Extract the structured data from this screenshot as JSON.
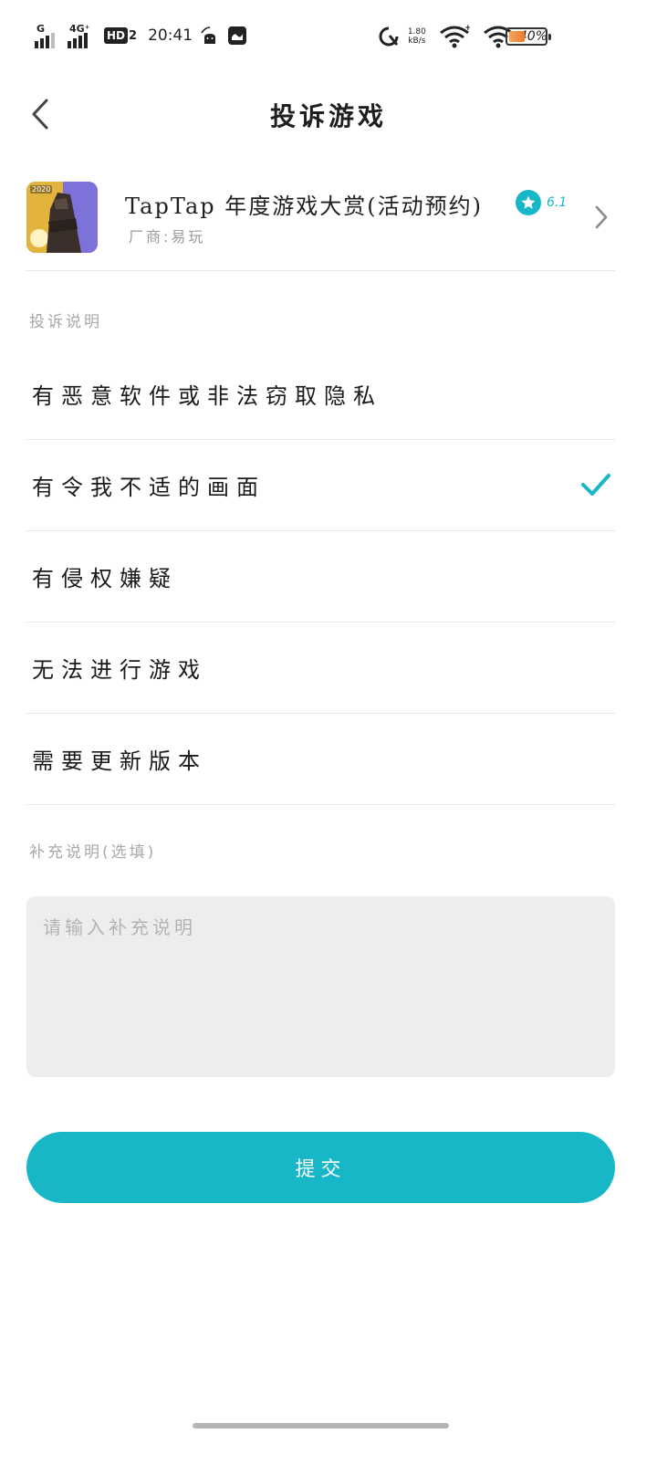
{
  "status_bar": {
    "sim1_label": "G",
    "sim2_label": "4G⁺",
    "hd_label": "HD",
    "hd_sub": "2",
    "time": "20:41",
    "speed_value": "1.80",
    "speed_unit": "kB/s",
    "battery_percent": "40%",
    "battery_level": 0.4
  },
  "header": {
    "title": "投诉游戏"
  },
  "game": {
    "icon_badge": "2020",
    "name": "TapTap 年度游戏大赏(活动预约)",
    "rating": "6.1",
    "vendor": "厂商:易玩"
  },
  "complaint": {
    "section_label": "投诉说明",
    "options": [
      {
        "label": "有恶意软件或非法窃取隐私",
        "selected": false
      },
      {
        "label": "有令我不适的画面",
        "selected": true
      },
      {
        "label": "有侵权嫌疑",
        "selected": false
      },
      {
        "label": "无法进行游戏",
        "selected": false
      },
      {
        "label": "需要更新版本",
        "selected": false
      }
    ]
  },
  "supplement": {
    "section_label": "补充说明(选填)",
    "placeholder": "请输入补充说明",
    "value": ""
  },
  "submit": {
    "label": "提交"
  },
  "colors": {
    "accent": "#18b7c8",
    "text": "#1f1f1f",
    "muted": "#a8a8a8",
    "divider": "#e6e6e6",
    "input_bg": "#ededed"
  }
}
